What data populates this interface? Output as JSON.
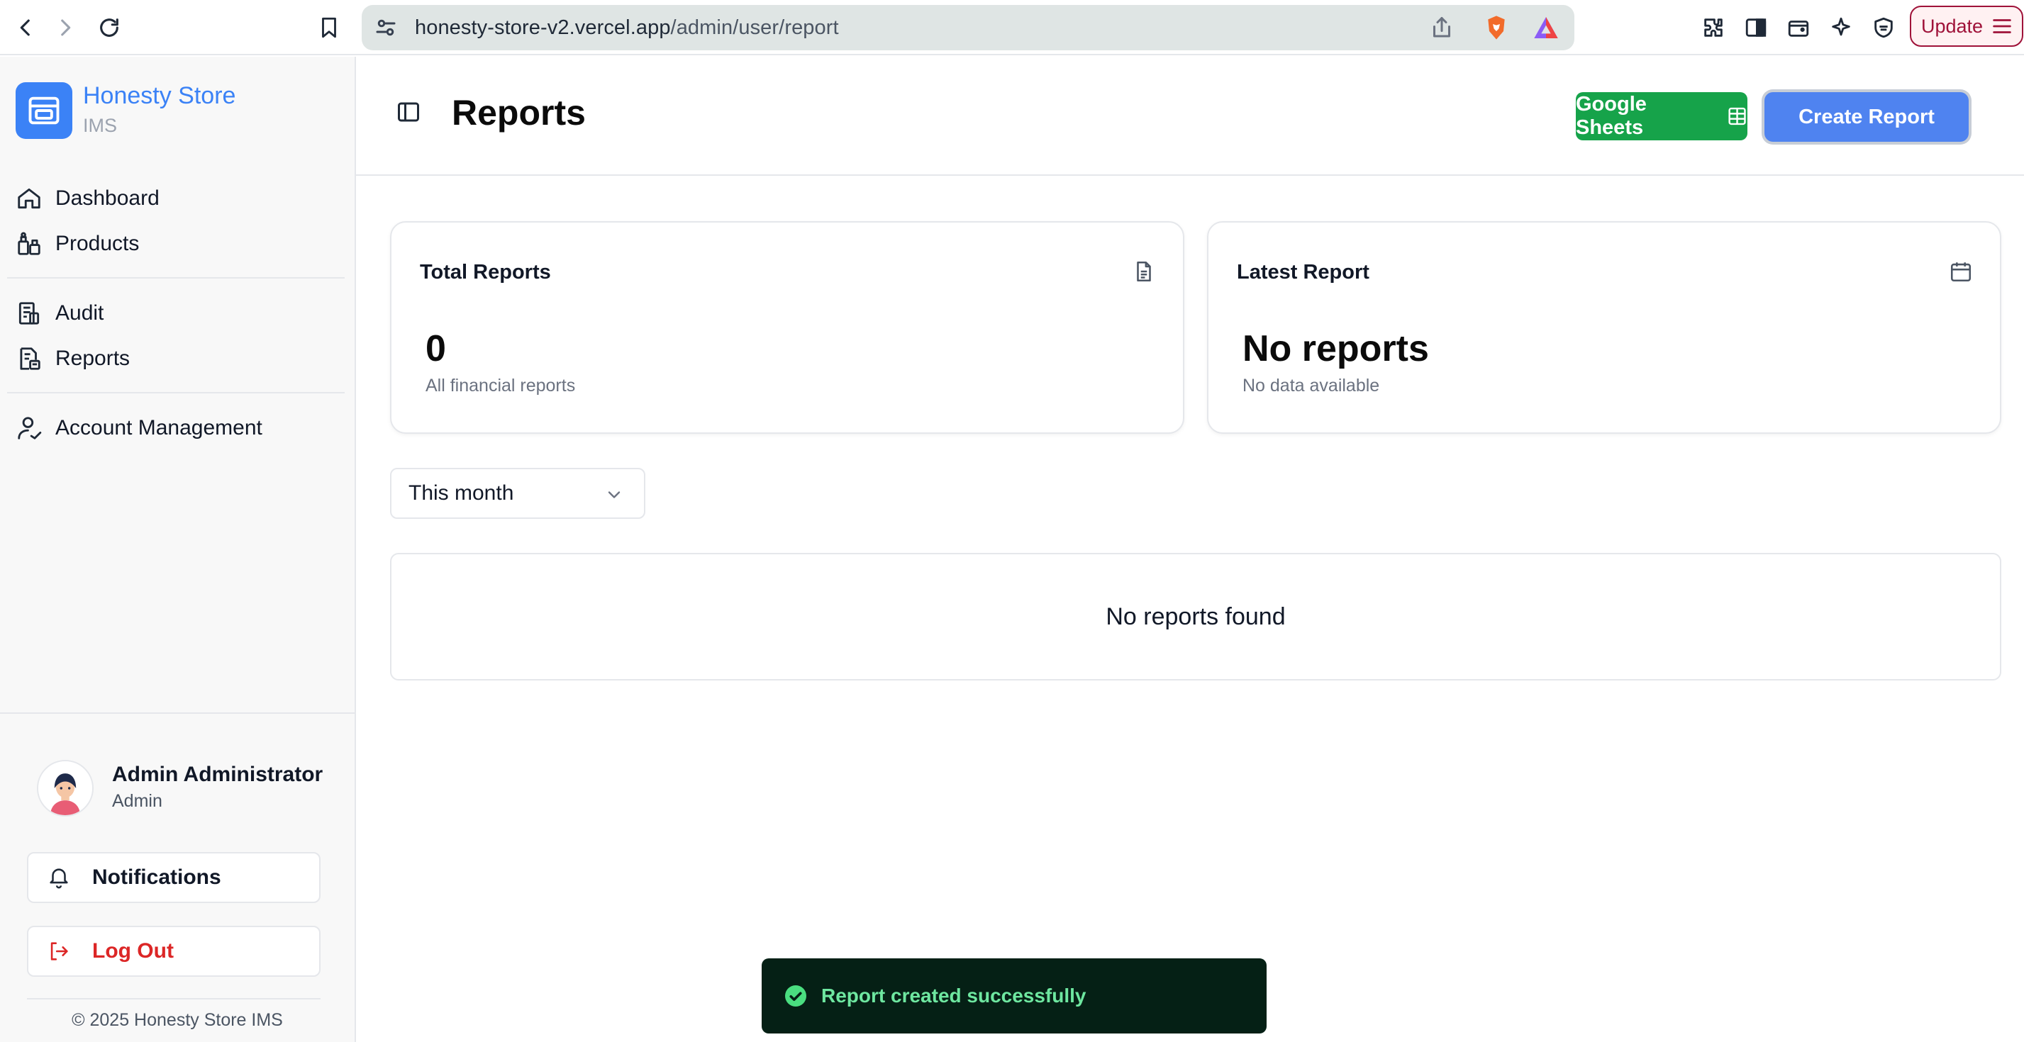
{
  "browser": {
    "url_host": "honesty-store-v2.vercel.app",
    "url_path": "/admin/user/report",
    "update_label": "Update"
  },
  "sidebar": {
    "brand_name": "Honesty Store",
    "brand_sub": "IMS",
    "items": [
      {
        "label": "Dashboard",
        "icon": "home-icon"
      },
      {
        "label": "Products",
        "icon": "products-icon"
      },
      {
        "label": "Audit",
        "icon": "audit-icon"
      },
      {
        "label": "Reports",
        "icon": "reports-icon"
      },
      {
        "label": "Account Management",
        "icon": "account-icon"
      }
    ],
    "user": {
      "name": "Admin Administrator",
      "role": "Admin"
    },
    "notifications_label": "Notifications",
    "logout_label": "Log Out",
    "copyright": "© 2025 Honesty Store IMS"
  },
  "header": {
    "title": "Reports",
    "google_sheets_label": "Google Sheets",
    "create_report_label": "Create Report"
  },
  "cards": {
    "total": {
      "title": "Total Reports",
      "value": "0",
      "sub": "All financial reports"
    },
    "latest": {
      "title": "Latest Report",
      "value": "No reports",
      "sub": "No data available"
    }
  },
  "filter": {
    "selected": "This month"
  },
  "list": {
    "empty_message": "No reports found"
  },
  "toast": {
    "message": "Report created successfully"
  },
  "colors": {
    "brand": "#3b82f6",
    "sheets_green": "#16a34a",
    "create_blue": "#4f83f0",
    "logout_red": "#dc2626",
    "toast_bg": "#052015",
    "toast_text": "#6ee7a0"
  }
}
